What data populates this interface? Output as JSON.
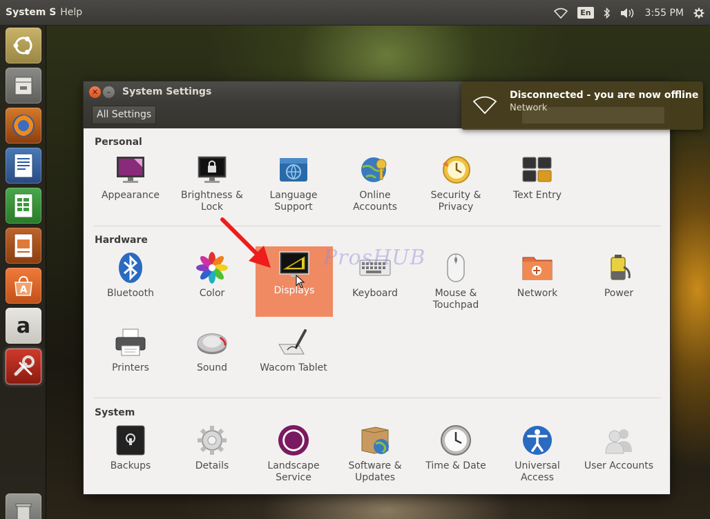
{
  "top_panel": {
    "app_name": "System S",
    "menu_help": "Help",
    "language": "En",
    "clock": "3:55 PM",
    "icons": [
      "wifi-icon",
      "bluetooth-icon",
      "volume-icon",
      "gear-icon"
    ]
  },
  "launcher": {
    "items": [
      "ubuntu-dash",
      "files",
      "firefox",
      "libreoffice-writer",
      "libreoffice-calc",
      "libreoffice-impress",
      "software-center",
      "amazon",
      "system-settings",
      "trash"
    ],
    "amazon_glyph": "a"
  },
  "window": {
    "title": "System Settings",
    "all_settings_label": "All Settings",
    "sections": [
      {
        "title": "Personal",
        "items": [
          {
            "label": "Appearance",
            "icon": "appearance-icon"
          },
          {
            "label": "Brightness & Lock",
            "icon": "brightness-lock-icon"
          },
          {
            "label": "Language Support",
            "icon": "language-support-icon"
          },
          {
            "label": "Online Accounts",
            "icon": "online-accounts-icon"
          },
          {
            "label": "Security & Privacy",
            "icon": "security-privacy-icon"
          },
          {
            "label": "Text Entry",
            "icon": "text-entry-icon"
          }
        ]
      },
      {
        "title": "Hardware",
        "items": [
          {
            "label": "Bluetooth",
            "icon": "bluetooth-icon"
          },
          {
            "label": "Color",
            "icon": "color-icon"
          },
          {
            "label": "Displays",
            "icon": "displays-icon",
            "selected": true
          },
          {
            "label": "Keyboard",
            "icon": "keyboard-icon"
          },
          {
            "label": "Mouse & Touchpad",
            "icon": "mouse-touchpad-icon"
          },
          {
            "label": "Network",
            "icon": "network-icon"
          },
          {
            "label": "Power",
            "icon": "power-icon"
          },
          {
            "label": "Printers",
            "icon": "printers-icon"
          },
          {
            "label": "Sound",
            "icon": "sound-icon"
          },
          {
            "label": "Wacom Tablet",
            "icon": "wacom-tablet-icon"
          }
        ]
      },
      {
        "title": "System",
        "items": [
          {
            "label": "Backups",
            "icon": "backups-icon"
          },
          {
            "label": "Details",
            "icon": "details-icon"
          },
          {
            "label": "Landscape Service",
            "icon": "landscape-service-icon"
          },
          {
            "label": "Software & Updates",
            "icon": "software-updates-icon"
          },
          {
            "label": "Time & Date",
            "icon": "time-date-icon"
          },
          {
            "label": "Universal Access",
            "icon": "universal-access-icon"
          },
          {
            "label": "User Accounts",
            "icon": "user-accounts-icon"
          }
        ]
      }
    ]
  },
  "notification": {
    "title": "Disconnected - you are now offline",
    "body": "Network",
    "icon": "wifi-icon"
  },
  "watermark": "ProsHUB",
  "colors": {
    "selected_item": "#ef8a63",
    "panel": "#3c3b37",
    "window_bg": "#f2f1f0",
    "close_button": "#e0521f"
  }
}
